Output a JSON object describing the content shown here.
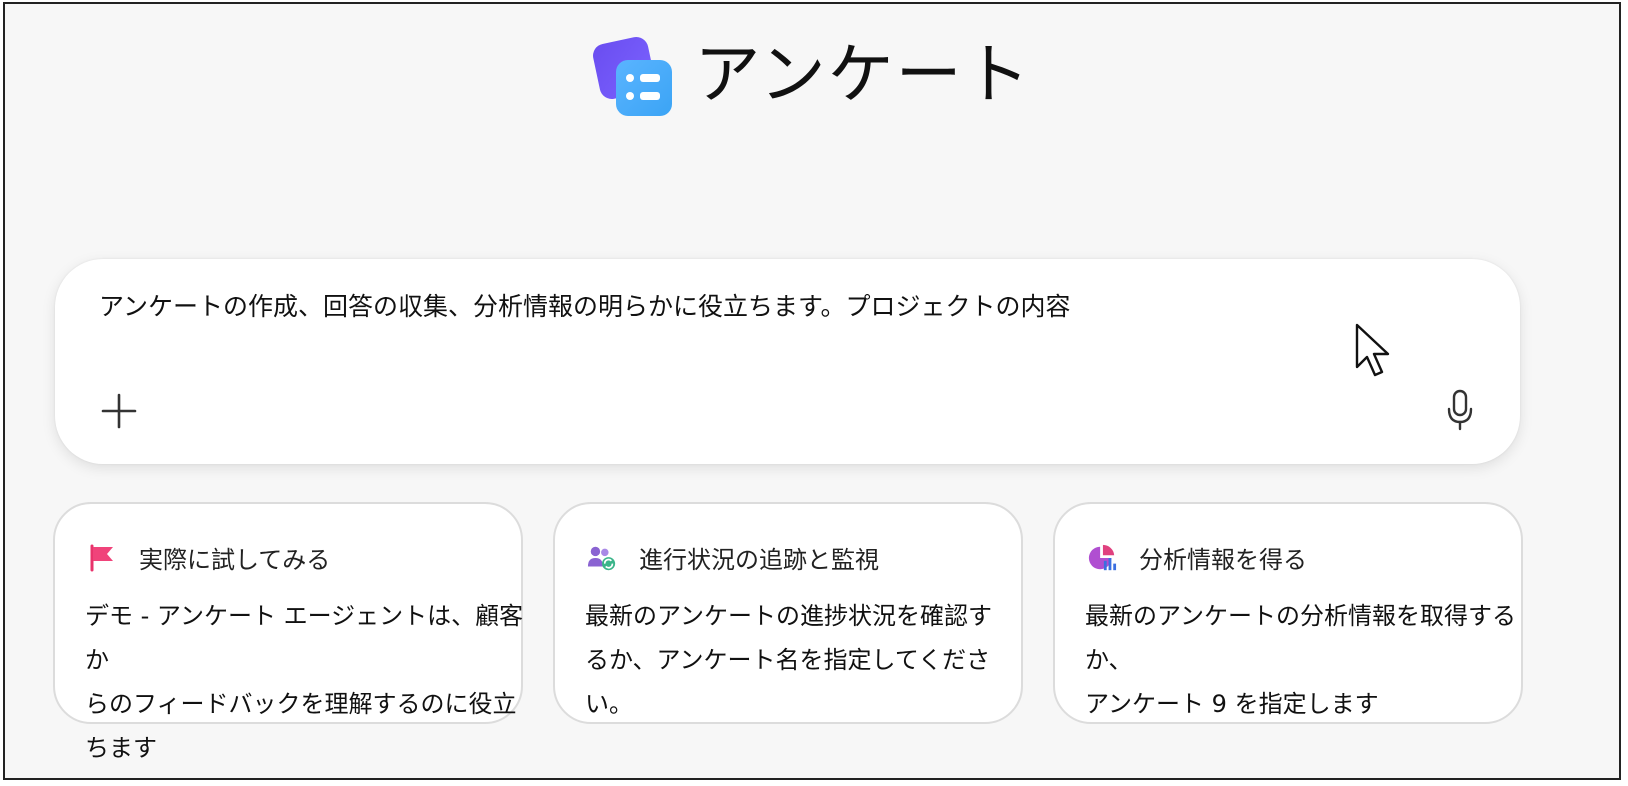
{
  "app": {
    "title": "アンケート",
    "logo_icon": "forms-app-icon",
    "brand_colors": {
      "logo_back": "#6a4df0",
      "logo_front": "#3ba4f5"
    }
  },
  "prompt": {
    "text": "アンケートの作成、回答の収集、分析情報の明らかに役立ちます。プロジェクトの内容",
    "add_icon": "plus-icon",
    "mic_icon": "microphone-icon"
  },
  "cards": [
    {
      "icon": "flag-icon",
      "title": "実際に試してみる",
      "desc_line1": "デモ - アンケート エージェントは、顧客か",
      "desc_line2": "らのフィードバックを理解するのに役立ちます"
    },
    {
      "icon": "people-sync-icon",
      "title": "進行状況の追跡と監視",
      "desc_line1": "最新のアンケートの進捗状況を確認す",
      "desc_line2": "るか、アンケート名を指定してください。"
    },
    {
      "icon": "pie-chart-icon",
      "title": "分析情報を得る",
      "desc_line1": "最新のアンケートの分析情報を取得するか、",
      "desc_line2": "アンケート 9 を指定します"
    }
  ]
}
